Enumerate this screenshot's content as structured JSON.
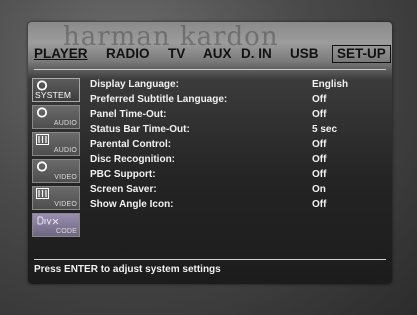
{
  "brand": "harman kardon",
  "tabs": [
    {
      "label": "PLAYER"
    },
    {
      "label": "RADIO"
    },
    {
      "label": "TV"
    },
    {
      "label": "AUX"
    },
    {
      "label": "D. IN"
    },
    {
      "label": "USB"
    },
    {
      "label": "SET-UP"
    }
  ],
  "active_tab": "PLAYER",
  "sidebar": {
    "items": [
      {
        "label": "SYSTEM",
        "icon": "disc-icon"
      },
      {
        "label": "AUDIO",
        "icon": "disc-icon"
      },
      {
        "label": "AUDIO",
        "icon": "equalizer-icon"
      },
      {
        "label": "VIDEO",
        "icon": "disc-icon"
      },
      {
        "label": "VIDEO",
        "icon": "equalizer-icon"
      },
      {
        "label": "CODE",
        "icon": "divx-logo"
      }
    ]
  },
  "settings": [
    {
      "label": "Display Language:",
      "value": "English"
    },
    {
      "label": "Preferred Subtitle Language:",
      "value": "Off"
    },
    {
      "label": "Panel Time-Out:",
      "value": "Off"
    },
    {
      "label": "Status Bar Time-Out:",
      "value": "5 sec"
    },
    {
      "label": "Parental Control:",
      "value": "Off"
    },
    {
      "label": "Disc Recognition:",
      "value": "Off"
    },
    {
      "label": "PBC Support:",
      "value": "Off"
    },
    {
      "label": "Screen Saver:",
      "value": "On"
    },
    {
      "label": "Show Angle Icon:",
      "value": "Off"
    }
  ],
  "status": "Press ENTER to adjust system settings",
  "colors": {
    "text": "#f2f2f2",
    "tab_text": "#111111"
  }
}
